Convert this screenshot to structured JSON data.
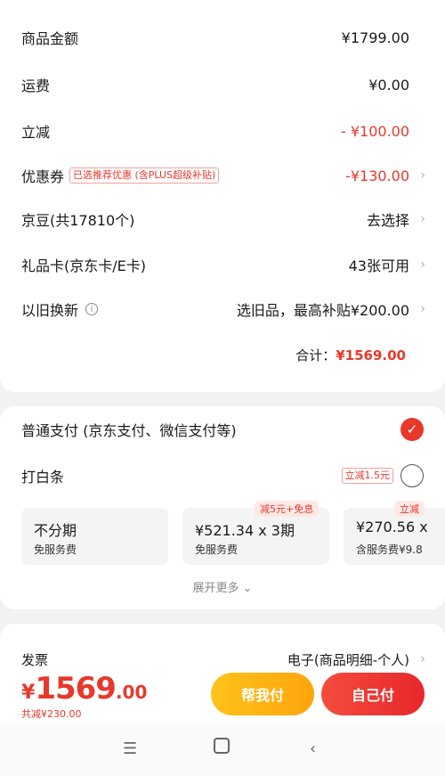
{
  "summary": {
    "rows": [
      {
        "label": "商品金额",
        "value": "¥1799.00"
      },
      {
        "label": "运费",
        "value": "¥0.00"
      },
      {
        "label": "立减",
        "value": "- ¥100.00"
      },
      {
        "label": "优惠券",
        "tag": "已选推荐优惠 (含PLUS超级补贴)",
        "value": "-¥130.00"
      },
      {
        "label": "京豆(共17810个)",
        "value": "去选择"
      },
      {
        "label": "礼品卡(京东卡/E卡)",
        "value": "43张可用"
      },
      {
        "label": "以旧换新",
        "value": "选旧品，最高补贴¥200.00"
      }
    ],
    "total_label": "合计：",
    "total_value": "¥1569.00"
  },
  "payment": {
    "normal_label": "普通支付 (京东支付、微信支付等)",
    "baitiao_label": "打白条",
    "baitiao_tag": "立减1.5元",
    "plans": [
      {
        "main": "不分期",
        "sub": "免服务费",
        "badge": ""
      },
      {
        "main": "¥521.34 x 3期",
        "sub": "免服务费",
        "badge": "减5元+免息"
      },
      {
        "main": "¥270.56 x",
        "sub": "含服务费¥9.8",
        "badge": "立减"
      }
    ],
    "expand_label": "展开更多"
  },
  "invoice": {
    "label": "发票",
    "value": "电子(商品明细-个人)"
  },
  "checkout": {
    "yen": "¥",
    "price_int": "1569",
    "price_dec": ".00",
    "saving": "共减¥230.00",
    "help_pay": "帮我付",
    "self_pay": "自己付"
  },
  "icons": {
    "chevron": "chevron-right-icon",
    "info": "info-icon",
    "check": "check-circle-icon"
  },
  "colors": {
    "accent_red": "#e8382c",
    "help_yellow": "#ffb21a"
  }
}
